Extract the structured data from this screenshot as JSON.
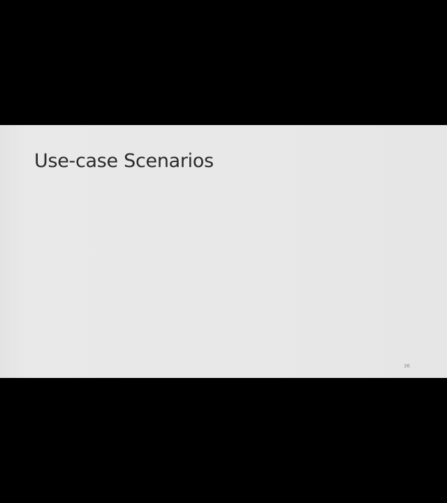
{
  "slide": {
    "title": "Use-case Scenarios",
    "page_number": "36"
  },
  "colors": {
    "letterbox": "#000000",
    "slide_background": "#e8e8e8",
    "title_text": "#2a2a2a",
    "page_number_text": "#8a8a8a"
  }
}
